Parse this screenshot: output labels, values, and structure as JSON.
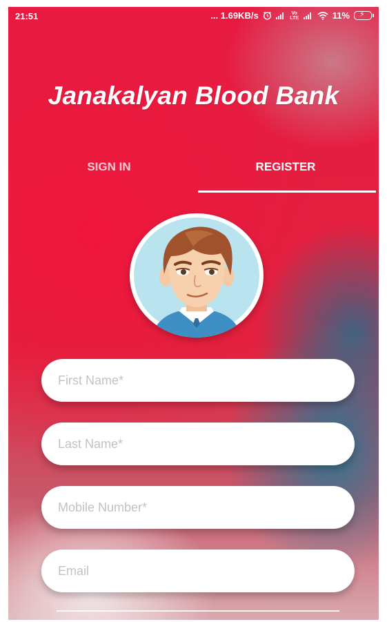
{
  "status_bar": {
    "time": "21:51",
    "network_speed": "... 1.69KB/s",
    "battery": "11%",
    "volte_label": "Vo LTE"
  },
  "app": {
    "title": "Janakalyan Blood Bank"
  },
  "tabs": [
    {
      "label": "SIGN IN",
      "active": false
    },
    {
      "label": "REGISTER",
      "active": true
    }
  ],
  "form": {
    "first_name": {
      "placeholder": "First Name*",
      "value": ""
    },
    "last_name": {
      "placeholder": "Last Name*",
      "value": ""
    },
    "mobile": {
      "placeholder": "Mobile Number*",
      "value": ""
    },
    "email": {
      "placeholder": "Email",
      "value": ""
    }
  },
  "colors": {
    "primary_red": "#e81a42",
    "teal": "#2a7896",
    "white": "#ffffff"
  },
  "icons": [
    "alarm-icon",
    "signal-icon",
    "wifi-icon",
    "battery-charging-icon",
    "avatar-icon"
  ]
}
